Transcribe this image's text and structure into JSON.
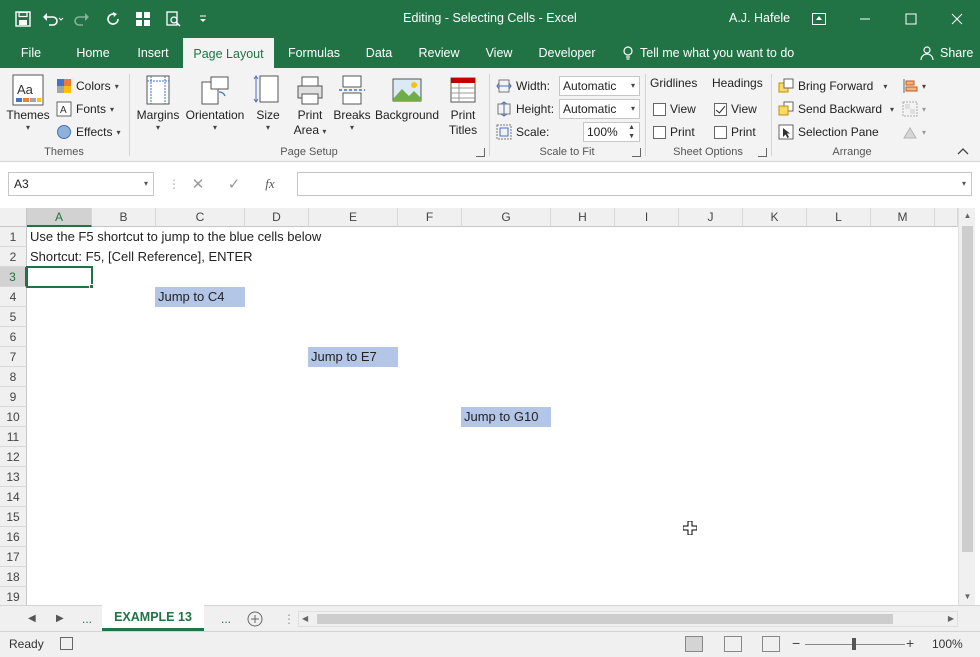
{
  "window": {
    "title": "Editing - Selecting Cells  -  Excel",
    "user": "A.J. Hafele",
    "quick_access_icons": [
      "save-icon",
      "undo-icon",
      "redo-icon",
      "repeat-icon",
      "form-icon",
      "print-preview-icon",
      "customize-qat-icon"
    ],
    "controls": [
      "ribbon-display-icon",
      "minimize-icon",
      "maximize-icon",
      "close-icon"
    ]
  },
  "ribbon_tabs": [
    "File",
    "Home",
    "Insert",
    "Page Layout",
    "Formulas",
    "Data",
    "Review",
    "View",
    "Developer"
  ],
  "active_tab": "Page Layout",
  "tell_me": "Tell me what you want to do",
  "share": "Share",
  "ribbon": {
    "themes": {
      "label": "Themes",
      "themes_btn": "Themes",
      "colors": "Colors",
      "fonts": "Fonts",
      "effects": "Effects"
    },
    "page_setup": {
      "label": "Page Setup",
      "margins": "Margins",
      "orientation": "Orientation",
      "size": "Size",
      "print_area_1": "Print",
      "print_area_2": "Area",
      "breaks": "Breaks",
      "background": "Background",
      "print_titles_1": "Print",
      "print_titles_2": "Titles"
    },
    "scale_to_fit": {
      "label": "Scale to Fit",
      "width_label": "Width:",
      "width_value": "Automatic",
      "height_label": "Height:",
      "height_value": "Automatic",
      "scale_label": "Scale:",
      "scale_value": "100%"
    },
    "sheet_options": {
      "label": "Sheet Options",
      "gridlines": "Gridlines",
      "headings": "Headings",
      "view": "View",
      "print": "Print",
      "gridlines_view": false,
      "gridlines_print": false,
      "headings_view": true,
      "headings_print": false
    },
    "arrange": {
      "label": "Arrange",
      "bring_forward": "Bring Forward",
      "send_backward": "Send Backward",
      "selection_pane": "Selection Pane"
    }
  },
  "formula_bar": {
    "name_box": "A3",
    "cancel": "✕",
    "enter": "✓",
    "fx": "fx",
    "formula": ""
  },
  "grid": {
    "columns": [
      "A",
      "B",
      "C",
      "D",
      "E",
      "F",
      "G",
      "H",
      "I",
      "J",
      "K",
      "L",
      "M"
    ],
    "rows": [
      "1",
      "2",
      "3",
      "4",
      "5",
      "6",
      "7",
      "8",
      "9",
      "10",
      "11",
      "12",
      "13",
      "14",
      "15",
      "16",
      "17",
      "18",
      "19"
    ],
    "selected_column": "A",
    "selected_row": "3",
    "cells": {
      "A1": "Use the F5 shortcut to jump to the blue cells below",
      "A2": "Shortcut: F5, [Cell Reference], ENTER",
      "C4": "Jump to C4",
      "E7": "Jump to E7",
      "G10": "Jump to G10"
    },
    "highlight_color": "#b4c6e7"
  },
  "sheet_tabs": {
    "active": "EXAMPLE 13",
    "more_left": "...",
    "more_right": "..."
  },
  "status_bar": {
    "ready": "Ready",
    "zoom": "100%"
  },
  "colors": {
    "brand": "#217346",
    "ribbon_bg": "#f3f3f3"
  }
}
